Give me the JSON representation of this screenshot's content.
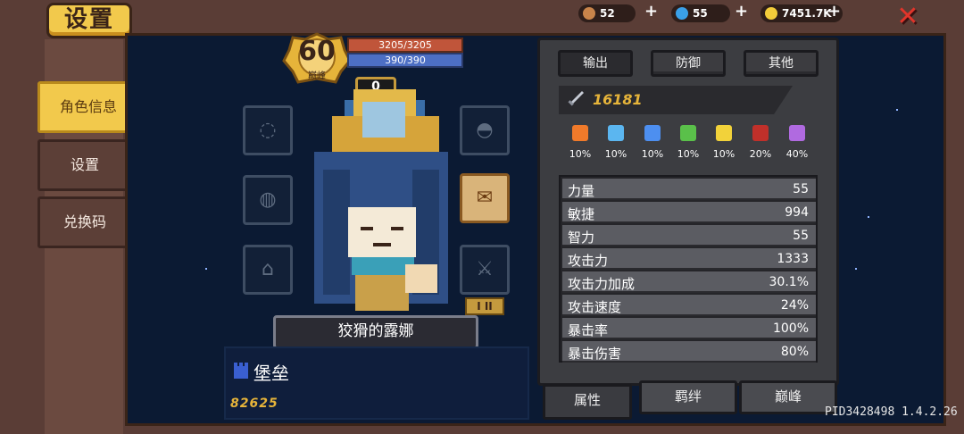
{
  "header": {
    "title": "设置",
    "resources": [
      {
        "icon": "meat-icon",
        "value": "52"
      },
      {
        "icon": "gem-icon",
        "value": "55"
      },
      {
        "icon": "coin-icon",
        "value": "7451.7K"
      }
    ],
    "plus": "+",
    "close": "✕"
  },
  "sidebar": {
    "items": [
      {
        "label": "角色信息",
        "active": true
      },
      {
        "label": "设置",
        "active": false
      },
      {
        "label": "兑换码",
        "active": false
      }
    ]
  },
  "character": {
    "level": "60",
    "level_tag": "巅峰",
    "hp": "3205/3205",
    "mp": "390/390",
    "armor": "0",
    "name": "狡猾的露娜",
    "skin_name": "堡垒",
    "power": "82625",
    "tier": "I II"
  },
  "equipment": {
    "slots": [
      {
        "icon": "ring-icon",
        "glyph": "◌"
      },
      {
        "icon": "helmet-icon",
        "glyph": "◓"
      },
      {
        "icon": "amulet-icon",
        "glyph": "◍"
      },
      {
        "icon": "weapon-scroll-icon",
        "glyph": "✉"
      },
      {
        "icon": "boots-icon",
        "glyph": "⌂"
      },
      {
        "icon": "sword-icon",
        "glyph": "⚔"
      }
    ]
  },
  "panel": {
    "tabs": [
      "输出",
      "防御",
      "其他"
    ],
    "attack": "16181",
    "elements": [
      {
        "icon": "fire-icon",
        "value": "10%",
        "color": "#f07a2a"
      },
      {
        "icon": "ice-icon",
        "value": "10%",
        "color": "#5bb6f0"
      },
      {
        "icon": "lightning-icon",
        "value": "10%",
        "color": "#4d8ff0"
      },
      {
        "icon": "poison-icon",
        "value": "10%",
        "color": "#5ac04a"
      },
      {
        "icon": "light-icon",
        "value": "10%",
        "color": "#f2d23a"
      },
      {
        "icon": "dark-icon",
        "value": "20%",
        "color": "#c0302a"
      },
      {
        "icon": "arcane-icon",
        "value": "40%",
        "color": "#b06ae0"
      }
    ],
    "stats": [
      {
        "k": "力量",
        "v": "55"
      },
      {
        "k": "敏捷",
        "v": "994"
      },
      {
        "k": "智力",
        "v": "55"
      },
      {
        "k": "攻击力",
        "v": "1333"
      },
      {
        "k": "攻击力加成",
        "v": "30.1%"
      },
      {
        "k": "攻击速度",
        "v": "24%"
      },
      {
        "k": "暴击率",
        "v": "100%"
      },
      {
        "k": "暴击伤害",
        "v": "80%"
      }
    ],
    "bottom_tabs": [
      "属性",
      "羁绊",
      "巅峰"
    ]
  },
  "footer": {
    "pid": "PID3428498 1.4.2.26"
  }
}
